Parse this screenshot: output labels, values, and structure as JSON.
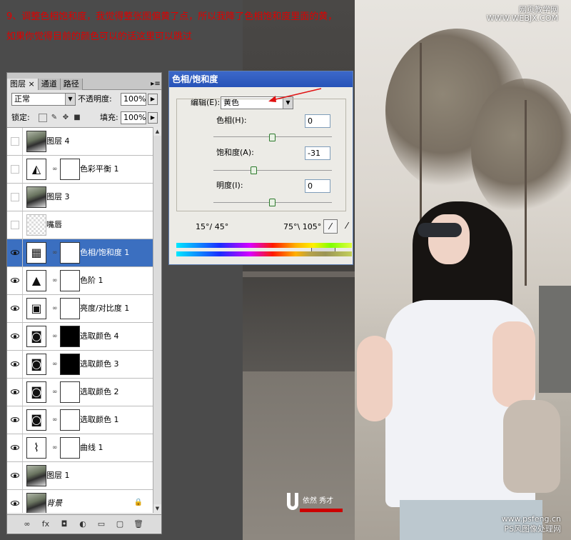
{
  "instructions": {
    "line1": "9、调整色相饱和度，我觉得整张图偏黄了点，所以我降了色相饱和度里面的黄，",
    "line2": "如果你觉得目前的颜色可以的话这里可以跳过"
  },
  "watermark_top": {
    "line1": "网页教学网",
    "line2": "WWW.WEBJX.COM"
  },
  "watermark_bottom": {
    "line1": "www.psfeng.cn",
    "line2": "PS风图像处理网"
  },
  "logo": {
    "name": "依然 秀才"
  },
  "layers_panel": {
    "tabs": [
      {
        "label": "图层"
      },
      {
        "label": "通道"
      },
      {
        "label": "路径"
      }
    ],
    "tab_close": "×",
    "blend_mode": "正常",
    "opacity_label": "不透明度:",
    "opacity_value": "100%",
    "lock_label": "锁定:",
    "fill_label": "填充:",
    "fill_value": "100%",
    "layers": [
      {
        "name": "图层 4",
        "visible": false,
        "thumb": "photo",
        "mask": null,
        "selected": false
      },
      {
        "name": "色彩平衡 1",
        "visible": false,
        "thumb": "adj",
        "glyph": "◭",
        "mask": "white",
        "selected": false
      },
      {
        "name": "图层 3",
        "visible": false,
        "thumb": "photo",
        "mask": null,
        "selected": false
      },
      {
        "name": "嘴唇",
        "visible": false,
        "thumb": "transparent",
        "mask": null,
        "selected": false
      },
      {
        "name": "色相/饱和度 1",
        "visible": true,
        "thumb": "adj",
        "glyph": "▦",
        "mask": "white",
        "selected": true
      },
      {
        "name": "色阶 1",
        "visible": true,
        "thumb": "adj",
        "glyph": "▲",
        "mask": "white",
        "selected": false
      },
      {
        "name": "亮度/对比度 1",
        "visible": true,
        "thumb": "adj",
        "glyph": "▣",
        "mask": "white",
        "selected": false
      },
      {
        "name": "选取颜色 4",
        "visible": true,
        "thumb": "adj",
        "glyph": "◙",
        "mask": "dark",
        "selected": false
      },
      {
        "name": "选取颜色 3",
        "visible": true,
        "thumb": "adj",
        "glyph": "◙",
        "mask": "dark",
        "selected": false
      },
      {
        "name": "选取颜色 2",
        "visible": true,
        "thumb": "adj",
        "glyph": "◙",
        "mask": "white",
        "selected": false
      },
      {
        "name": "选取颜色 1",
        "visible": true,
        "thumb": "adj",
        "glyph": "◙",
        "mask": "white",
        "selected": false
      },
      {
        "name": "曲线 1",
        "visible": true,
        "thumb": "adj",
        "glyph": "⌇",
        "mask": "white",
        "selected": false
      },
      {
        "name": "图层 1",
        "visible": true,
        "thumb": "photo",
        "mask": null,
        "selected": false
      },
      {
        "name": "背景",
        "visible": true,
        "thumb": "photo",
        "mask": null,
        "selected": false,
        "locked": true
      }
    ],
    "footer_icons": [
      "link-icon",
      "fx-icon",
      "add-mask-icon",
      "adjustment-layer-icon",
      "group-folder-icon",
      "new-layer-icon",
      "trash-icon"
    ],
    "footer_glyphs": [
      "∞",
      "fx",
      "◘",
      "◐",
      "▭",
      "▢",
      "🗑"
    ]
  },
  "huesat_dialog": {
    "title": "色相/饱和度",
    "edit_label": "编辑(E):",
    "edit_value": "黄色",
    "hue_label": "色相(H):",
    "hue_value": "0",
    "saturation_label": "饱和度(A):",
    "saturation_value": "-31",
    "lightness_label": "明度(I):",
    "lightness_value": "0",
    "range_left": "15°/ 45°",
    "range_right": "75°\\ 105°",
    "hue_level": 0,
    "saturation_level": -31,
    "lightness_level": 0
  },
  "colors": {
    "instruction_red": "#e00000",
    "selected_blue": "#3b6fc0",
    "title_blue": "#2f5fc4"
  }
}
